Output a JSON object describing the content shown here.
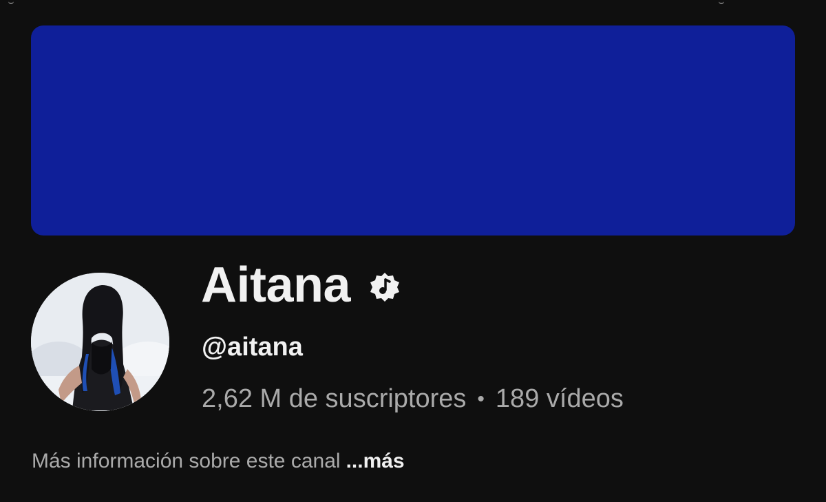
{
  "banner": {
    "color": "#0f1f99"
  },
  "channel": {
    "name": "Aitana",
    "handle": "@aitana",
    "subscribers": "2,62 M de suscriptores",
    "separator": "•",
    "videos": "189 vídeos",
    "verified_icon": "music-note-verified-icon"
  },
  "about": {
    "text": "Más información sobre este canal",
    "more_label": "...más"
  },
  "colors": {
    "background": "#0f0f0f",
    "primary_text": "#f1f1f1",
    "secondary_text": "#aaaaaa"
  }
}
